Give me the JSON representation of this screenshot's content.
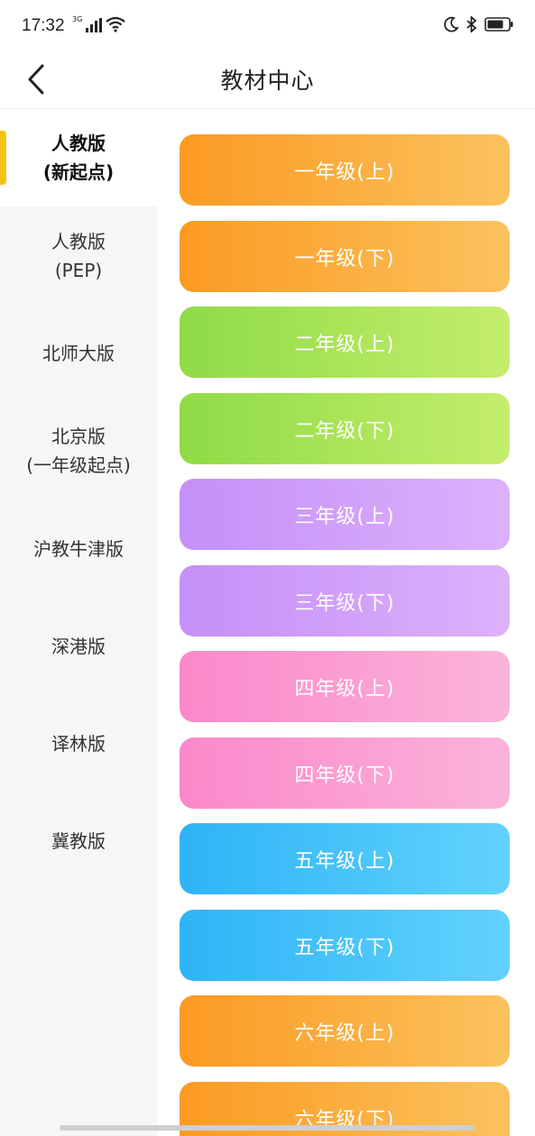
{
  "status_bar": {
    "time": "17:32",
    "network": "3G",
    "icons": [
      "signal-icon",
      "wifi-icon",
      "moon-icon",
      "bluetooth-icon",
      "battery-icon"
    ]
  },
  "header": {
    "title": "教材中心",
    "back_icon": "chevron-left-icon"
  },
  "sidebar": {
    "active_index": 0,
    "accent_color": "#f7c20f",
    "items": [
      {
        "line1": "人教版",
        "line2": "(新起点)"
      },
      {
        "line1": "人教版",
        "line2": "(PEP)"
      },
      {
        "line1": "北师大版",
        "line2": ""
      },
      {
        "line1": "北京版",
        "line2": "(一年级起点)"
      },
      {
        "line1": "沪教牛津版",
        "line2": ""
      },
      {
        "line1": "深港版",
        "line2": ""
      },
      {
        "line1": "译林版",
        "line2": ""
      },
      {
        "line1": "冀教版",
        "line2": ""
      }
    ]
  },
  "grades": [
    {
      "label": "一年级(上)",
      "color": "orange"
    },
    {
      "label": "一年级(下)",
      "color": "orange"
    },
    {
      "label": "二年级(上)",
      "color": "green"
    },
    {
      "label": "二年级(下)",
      "color": "green"
    },
    {
      "label": "三年级(上)",
      "color": "purple"
    },
    {
      "label": "三年级(下)",
      "color": "purple"
    },
    {
      "label": "四年级(上)",
      "color": "pink"
    },
    {
      "label": "四年级(下)",
      "color": "pink"
    },
    {
      "label": "五年级(上)",
      "color": "blue"
    },
    {
      "label": "五年级(下)",
      "color": "blue"
    },
    {
      "label": "六年级(上)",
      "color": "orange"
    },
    {
      "label": "六年级(下)",
      "color": "orange"
    }
  ],
  "colors": {
    "orange": "#fb9a22",
    "green": "#8fdb46",
    "purple": "#c58ff8",
    "pink": "#fb88c9",
    "blue": "#2db4f6"
  }
}
